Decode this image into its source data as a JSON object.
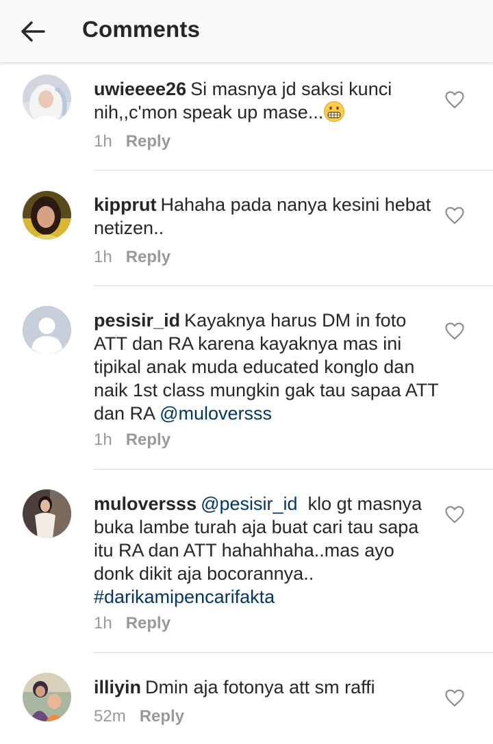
{
  "header": {
    "title": "Comments"
  },
  "comments": [
    {
      "username": "uwieeee26",
      "text_part1": "Si masnya jd saksi kunci nih,,c'mon speak up mase...",
      "time": "1h",
      "reply_label": "Reply",
      "avatar_icon": "avatar-photo-woman-hijab"
    },
    {
      "username": "kipprut",
      "text": "Hahaha pada nanya kesini hebat netizen..",
      "time": "1h",
      "reply_label": "Reply",
      "avatar_icon": "avatar-photo-woman"
    },
    {
      "username": "pesisir_id",
      "text": "Kayaknya harus DM in foto ATT dan RA karena kayaknya mas ini tipikal anak muda educated konglo dan naik 1st class mungkin gak tau sapaa ATT dan RA",
      "mention": "@muloversss",
      "time": "1h",
      "reply_label": "Reply",
      "avatar_icon": "default-avatar-icon"
    },
    {
      "username": "muloversss",
      "mention": "@pesisir_id",
      "text": "klo gt masnya buka lambe turah aja buat cari tau sapa itu RA dan ATT hahahhaha..mas ayo donk dikit aja bocorannya..",
      "hashtag": "#darikamipencarifakta",
      "time": "1h",
      "reply_label": "Reply",
      "avatar_icon": "avatar-photo-woman-dress"
    },
    {
      "username": "illiyin",
      "text": "Dmin aja fotonya att sm raffi",
      "time": "52m",
      "reply_label": "Reply",
      "avatar_icon": "avatar-photo-family"
    }
  ]
}
